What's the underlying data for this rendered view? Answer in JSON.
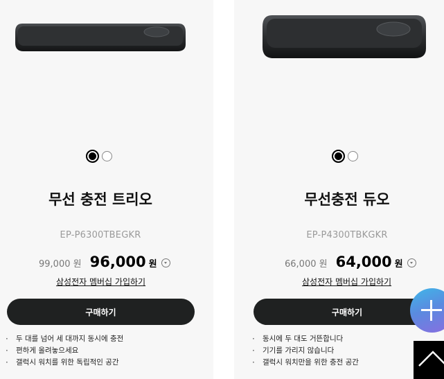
{
  "products": [
    {
      "name": "무선 충전 트리오",
      "sku": "EP-P6300TBEGKR",
      "original_price": "99,000 원",
      "sale_price": "96,000",
      "currency": "원",
      "membership_link": "삼성전자 멤버십 가입하기",
      "buy_label": "구매하기",
      "colors": [
        "#000000",
        "#ffffff"
      ],
      "features": [
        "두 대를 넘어 세 대까지 동시에 충전",
        "편하게 올려놓으세요",
        "갤럭시 워치를 위한 독립적인 공간"
      ]
    },
    {
      "name": "무선충전 듀오",
      "sku": "EP-P4300TBKGKR",
      "original_price": "66,000 원",
      "sale_price": "64,000",
      "currency": "원",
      "membership_link": "삼성전자 멤버십 가입하기",
      "buy_label": "구매하기",
      "colors": [
        "#000000",
        "#ffffff"
      ],
      "features": [
        "동시에 두 대도 거뜬합니다",
        "기기를 가리지 않습니다",
        "갤럭시 워치만을 위한 충전 공간"
      ]
    }
  ],
  "floating": {
    "plus_icon": "plus-icon",
    "top_icon": "chevron-up-icon"
  }
}
